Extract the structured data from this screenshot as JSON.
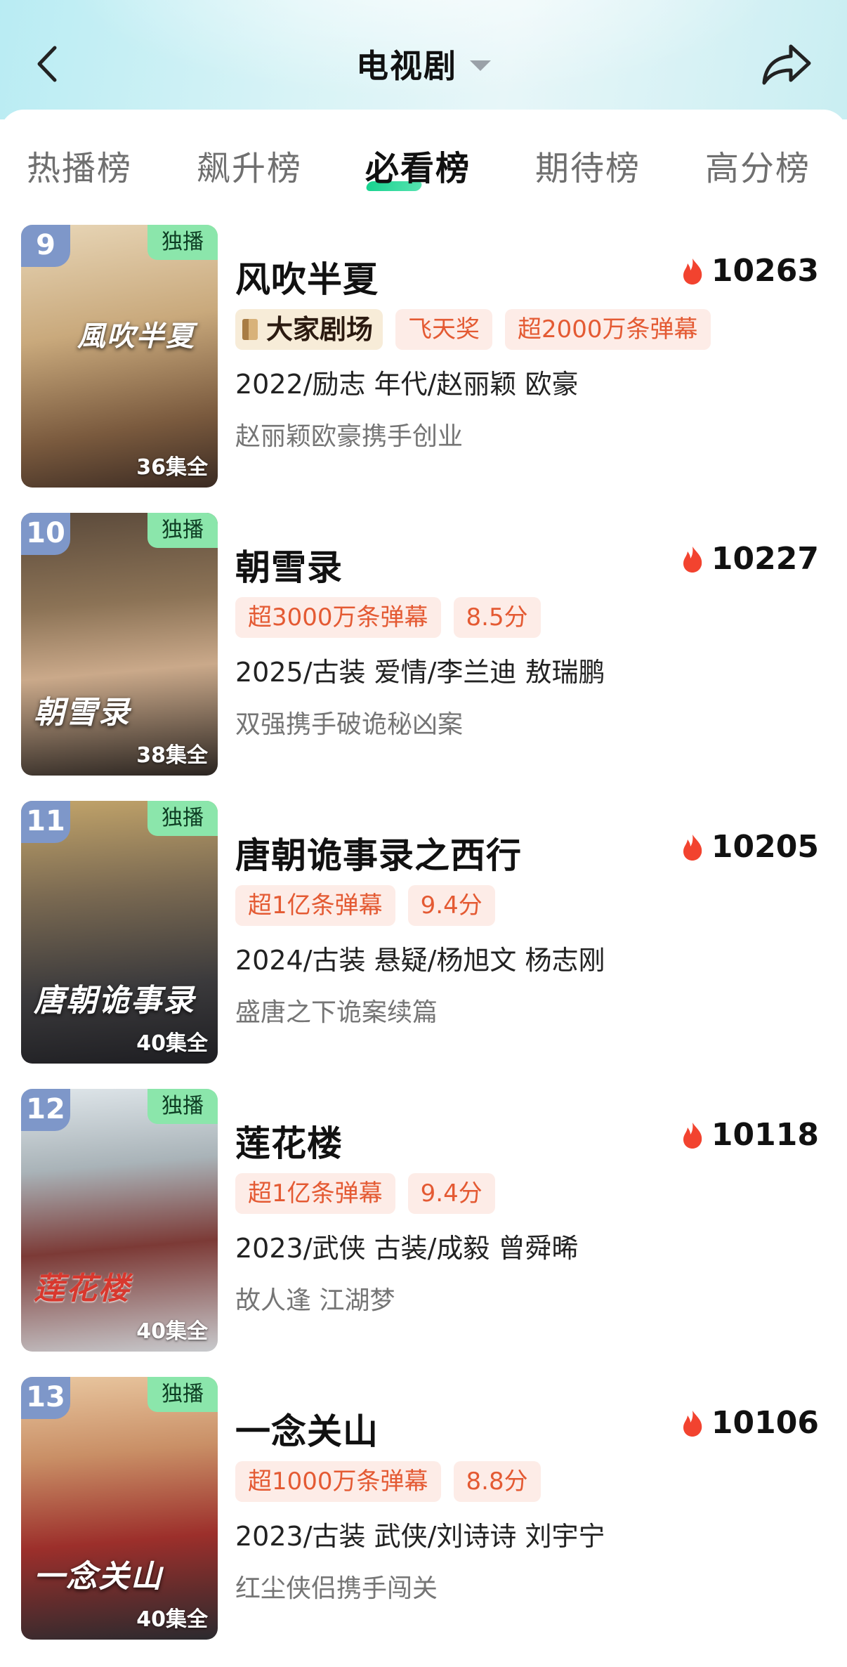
{
  "header": {
    "title": "电视剧",
    "back_icon": "chevron-left-icon",
    "share_icon": "share-arrow-icon"
  },
  "tabs": [
    {
      "label": "热播榜",
      "active": false
    },
    {
      "label": "飙升榜",
      "active": false
    },
    {
      "label": "必看榜",
      "active": true
    },
    {
      "label": "期待榜",
      "active": false
    },
    {
      "label": "高分榜",
      "active": false
    }
  ],
  "colors": {
    "accent": "#18d38f",
    "tag_text": "#e45a33",
    "tag_bg": "#fdece7",
    "rank_badge": "#7e97c9",
    "exclusive_badge": "#8be6ab"
  },
  "items": [
    {
      "rank": "9",
      "badge": "独播",
      "episodes": "36集全",
      "poster_title": "風吹半夏",
      "title": "风吹半夏",
      "heat": "10263",
      "tags": [
        {
          "text": "大家剧场",
          "brand": true
        },
        {
          "text": "飞天奖"
        },
        {
          "text": "超2000万条弹幕"
        }
      ],
      "meta": "2022/励志 年代/赵丽颖 欧豪",
      "desc": "赵丽颖欧豪携手创业"
    },
    {
      "rank": "10",
      "badge": "独播",
      "episodes": "38集全",
      "poster_title": "朝雪录",
      "title": "朝雪录",
      "heat": "10227",
      "tags": [
        {
          "text": "超3000万条弹幕"
        },
        {
          "text": "8.5分"
        }
      ],
      "meta": "2025/古装 爱情/李兰迪 敖瑞鹏",
      "desc": "双强携手破诡秘凶案"
    },
    {
      "rank": "11",
      "badge": "独播",
      "episodes": "40集全",
      "poster_title": "唐朝诡事录",
      "title": "唐朝诡事录之西行",
      "heat": "10205",
      "tags": [
        {
          "text": "超1亿条弹幕"
        },
        {
          "text": "9.4分"
        }
      ],
      "meta": "2024/古装 悬疑/杨旭文 杨志刚",
      "desc": "盛唐之下诡案续篇"
    },
    {
      "rank": "12",
      "badge": "独播",
      "episodes": "40集全",
      "poster_title": "莲花楼",
      "title": "莲花楼",
      "heat": "10118",
      "tags": [
        {
          "text": "超1亿条弹幕"
        },
        {
          "text": "9.4分"
        }
      ],
      "meta": "2023/武侠 古装/成毅 曾舜晞",
      "desc": "故人逢 江湖梦"
    },
    {
      "rank": "13",
      "badge": "独播",
      "episodes": "40集全",
      "poster_title": "一念关山",
      "title": "一念关山",
      "heat": "10106",
      "tags": [
        {
          "text": "超1000万条弹幕"
        },
        {
          "text": "8.8分"
        }
      ],
      "meta": "2023/古装 武侠/刘诗诗 刘宇宁",
      "desc": "红尘侠侣携手闯关"
    }
  ]
}
